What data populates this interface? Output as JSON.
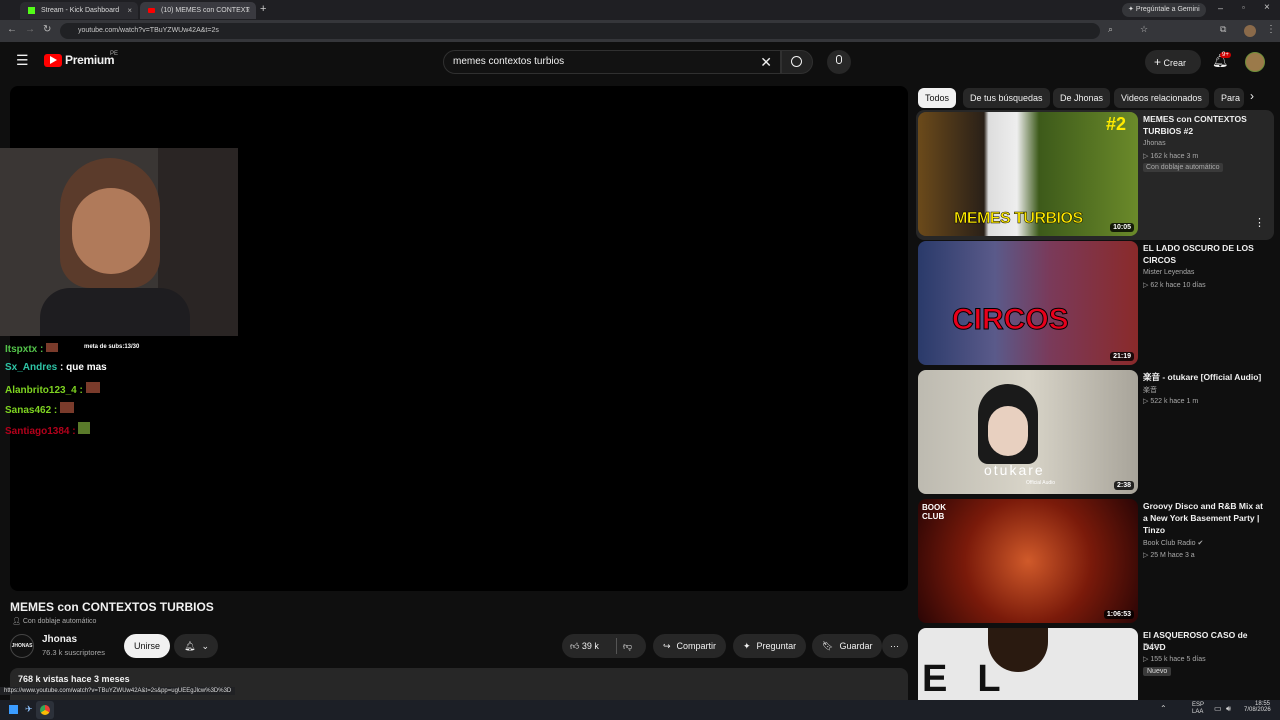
{
  "browser": {
    "tabs": [
      {
        "title": "Stream - Kick Dashboard",
        "close": "×"
      },
      {
        "title": "(10) MEMES con CONTEXT",
        "close": "×"
      }
    ],
    "new_tab": "+",
    "gemini": "Pregúntale a Gemini",
    "url": "youtube.com/watch?v=TBuYZWUw42A&t=2s",
    "status_url": "https://www.youtube.com/watch?v=TBuYZWUw42A&t=2s&pp=ugUEEgJlcw%3D%3D"
  },
  "youtube": {
    "logo": "Premium",
    "logo_badge": "PE",
    "search_value": "memes contextos turbios",
    "create_label": "Crear",
    "notif_count": "9+",
    "chips": [
      "Todos",
      "De tus búsquedas",
      "De Jhonas",
      "Videos relacionados",
      "Para"
    ],
    "video": {
      "title": "MEMES con CONTEXTOS TURBIOS",
      "dub_label": "Con doblaje automático",
      "channel": "Jhonas",
      "subs": "76.3 k suscriptores",
      "join": "Unirse",
      "likes": "39 k",
      "share": "Compartir",
      "ask": "Preguntar",
      "save": "Guardar",
      "views": "768 k vistas  hace 3 meses"
    },
    "overlay": {
      "goal": "meta de subs:13/30",
      "chat": [
        {
          "user": "Itspxtx",
          "msg": ""
        },
        {
          "user": "Sx_Andres",
          "msg": "que mas"
        },
        {
          "user": "Alanbrito123_4",
          "msg": ""
        },
        {
          "user": "Sanas462",
          "msg": ""
        },
        {
          "user": "Santiago1384",
          "msg": ""
        }
      ]
    },
    "recs": [
      {
        "title": "MEMES con CONTEXTOS TURBIOS #2",
        "channel": "Jhonas",
        "meta": "162 k   hace 3 m",
        "badge": "Con doblaje automático",
        "duration": "10:05",
        "thumb_text": "MEMES TURBIOS",
        "thumb_tag": "#2"
      },
      {
        "title": "EL LADO OSCURO DE LOS CIRCOS",
        "channel": "Mister Leyendas",
        "meta": "62 k   hace 10 días",
        "duration": "21:19",
        "thumb_text": "CIRCOS"
      },
      {
        "title": "楽音 - otukare [Official Audio]",
        "channel": "楽音",
        "meta": "522 k   hace 1 m",
        "duration": "2:38",
        "thumb_text": "otukare",
        "thumb_sub": "Official Audio"
      },
      {
        "title": "Groovy Disco and R&B Mix at a New York Basement Party | Tinzo",
        "channel": "Book Club Radio",
        "meta": "25 M   hace 3 a",
        "duration": "1:06:53",
        "thumb_text": "BOOK CLUB"
      },
      {
        "title": "El ASQUEROSO CASO de D4VD",
        "channel": "Rulsu",
        "meta": "155 k   hace 5 días",
        "badge": "Nuevo",
        "thumb_text": "EL FIN"
      }
    ]
  },
  "taskbar": {
    "lang": "ESP\nLAA",
    "time": "18:55",
    "date": "7/08/2026"
  },
  "colors": {
    "accent_red": "#ff0000",
    "chip_active": "#f1f1f1"
  }
}
